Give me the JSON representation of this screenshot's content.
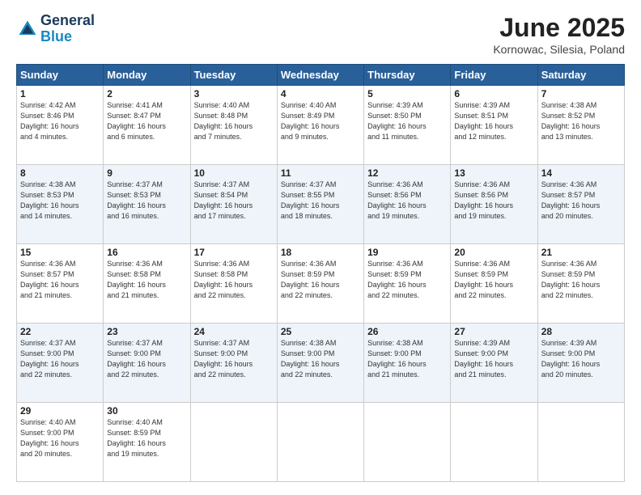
{
  "logo": {
    "line1": "General",
    "line2": "Blue"
  },
  "title": "June 2025",
  "subtitle": "Kornowac, Silesia, Poland",
  "headers": [
    "Sunday",
    "Monday",
    "Tuesday",
    "Wednesday",
    "Thursday",
    "Friday",
    "Saturday"
  ],
  "weeks": [
    [
      {
        "day": "1",
        "sunrise": "4:42 AM",
        "sunset": "8:46 PM",
        "daylight": "16 hours and 4 minutes."
      },
      {
        "day": "2",
        "sunrise": "4:41 AM",
        "sunset": "8:47 PM",
        "daylight": "16 hours and 6 minutes."
      },
      {
        "day": "3",
        "sunrise": "4:40 AM",
        "sunset": "8:48 PM",
        "daylight": "16 hours and 7 minutes."
      },
      {
        "day": "4",
        "sunrise": "4:40 AM",
        "sunset": "8:49 PM",
        "daylight": "16 hours and 9 minutes."
      },
      {
        "day": "5",
        "sunrise": "4:39 AM",
        "sunset": "8:50 PM",
        "daylight": "16 hours and 11 minutes."
      },
      {
        "day": "6",
        "sunrise": "4:39 AM",
        "sunset": "8:51 PM",
        "daylight": "16 hours and 12 minutes."
      },
      {
        "day": "7",
        "sunrise": "4:38 AM",
        "sunset": "8:52 PM",
        "daylight": "16 hours and 13 minutes."
      }
    ],
    [
      {
        "day": "8",
        "sunrise": "4:38 AM",
        "sunset": "8:53 PM",
        "daylight": "16 hours and 14 minutes."
      },
      {
        "day": "9",
        "sunrise": "4:37 AM",
        "sunset": "8:53 PM",
        "daylight": "16 hours and 16 minutes."
      },
      {
        "day": "10",
        "sunrise": "4:37 AM",
        "sunset": "8:54 PM",
        "daylight": "16 hours and 17 minutes."
      },
      {
        "day": "11",
        "sunrise": "4:37 AM",
        "sunset": "8:55 PM",
        "daylight": "16 hours and 18 minutes."
      },
      {
        "day": "12",
        "sunrise": "4:36 AM",
        "sunset": "8:56 PM",
        "daylight": "16 hours and 19 minutes."
      },
      {
        "day": "13",
        "sunrise": "4:36 AM",
        "sunset": "8:56 PM",
        "daylight": "16 hours and 19 minutes."
      },
      {
        "day": "14",
        "sunrise": "4:36 AM",
        "sunset": "8:57 PM",
        "daylight": "16 hours and 20 minutes."
      }
    ],
    [
      {
        "day": "15",
        "sunrise": "4:36 AM",
        "sunset": "8:57 PM",
        "daylight": "16 hours and 21 minutes."
      },
      {
        "day": "16",
        "sunrise": "4:36 AM",
        "sunset": "8:58 PM",
        "daylight": "16 hours and 21 minutes."
      },
      {
        "day": "17",
        "sunrise": "4:36 AM",
        "sunset": "8:58 PM",
        "daylight": "16 hours and 22 minutes."
      },
      {
        "day": "18",
        "sunrise": "4:36 AM",
        "sunset": "8:59 PM",
        "daylight": "16 hours and 22 minutes."
      },
      {
        "day": "19",
        "sunrise": "4:36 AM",
        "sunset": "8:59 PM",
        "daylight": "16 hours and 22 minutes."
      },
      {
        "day": "20",
        "sunrise": "4:36 AM",
        "sunset": "8:59 PM",
        "daylight": "16 hours and 22 minutes."
      },
      {
        "day": "21",
        "sunrise": "4:36 AM",
        "sunset": "8:59 PM",
        "daylight": "16 hours and 22 minutes."
      }
    ],
    [
      {
        "day": "22",
        "sunrise": "4:37 AM",
        "sunset": "9:00 PM",
        "daylight": "16 hours and 22 minutes."
      },
      {
        "day": "23",
        "sunrise": "4:37 AM",
        "sunset": "9:00 PM",
        "daylight": "16 hours and 22 minutes."
      },
      {
        "day": "24",
        "sunrise": "4:37 AM",
        "sunset": "9:00 PM",
        "daylight": "16 hours and 22 minutes."
      },
      {
        "day": "25",
        "sunrise": "4:38 AM",
        "sunset": "9:00 PM",
        "daylight": "16 hours and 22 minutes."
      },
      {
        "day": "26",
        "sunrise": "4:38 AM",
        "sunset": "9:00 PM",
        "daylight": "16 hours and 21 minutes."
      },
      {
        "day": "27",
        "sunrise": "4:39 AM",
        "sunset": "9:00 PM",
        "daylight": "16 hours and 21 minutes."
      },
      {
        "day": "28",
        "sunrise": "4:39 AM",
        "sunset": "9:00 PM",
        "daylight": "16 hours and 20 minutes."
      }
    ],
    [
      {
        "day": "29",
        "sunrise": "4:40 AM",
        "sunset": "9:00 PM",
        "daylight": "16 hours and 20 minutes."
      },
      {
        "day": "30",
        "sunrise": "4:40 AM",
        "sunset": "8:59 PM",
        "daylight": "16 hours and 19 minutes."
      },
      null,
      null,
      null,
      null,
      null
    ]
  ],
  "labels": {
    "sunrise": "Sunrise:",
    "sunset": "Sunset:",
    "daylight": "Daylight:"
  }
}
